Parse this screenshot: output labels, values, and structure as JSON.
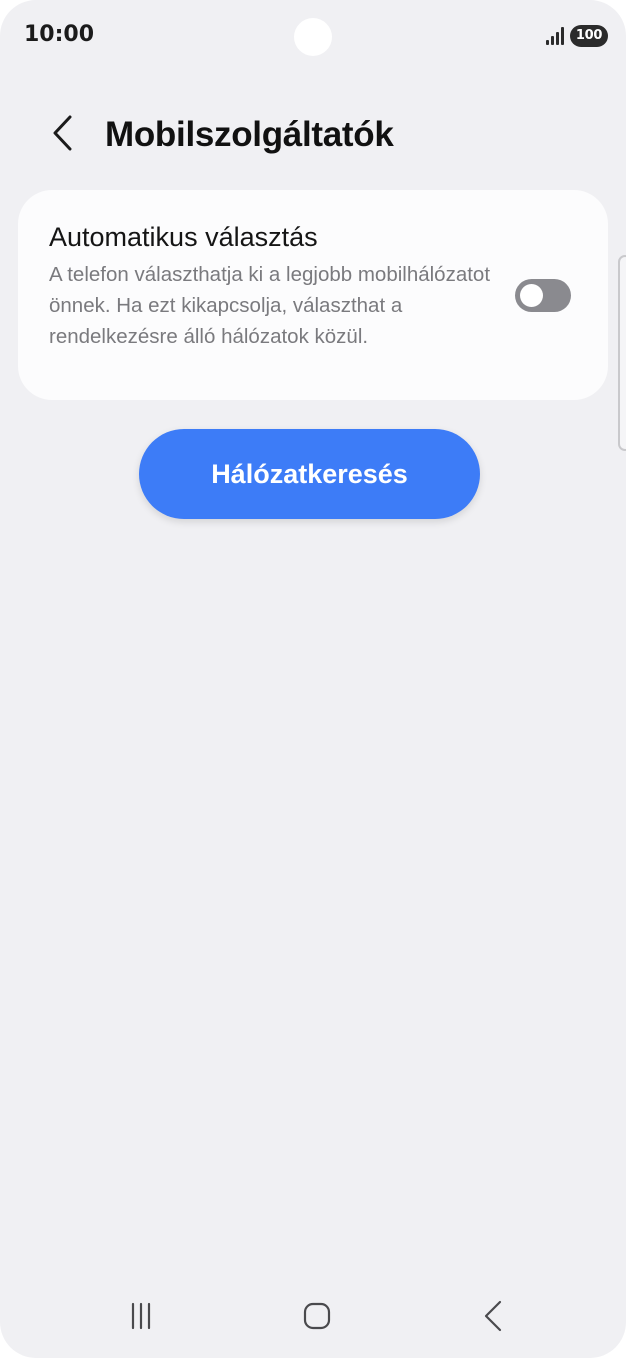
{
  "status_bar": {
    "time": "10:00",
    "battery": "100",
    "signal_icon": "signal-icon",
    "battery_icon": "battery-icon"
  },
  "header": {
    "back_icon": "chevron-left-icon",
    "title": "Mobilszolgáltatók"
  },
  "setting": {
    "title": "Automatikus választás",
    "description": "A telefon választhatja ki a legjobb mobilhálózatot önnek. Ha ezt kikapcsolja, választhat a rendelkezésre álló hálózatok közül.",
    "toggle_on": false
  },
  "search_button": {
    "label": "Hálózatkeresés"
  },
  "nav_bar": {
    "recent_icon": "recent-apps-icon",
    "home_icon": "home-icon",
    "back_icon": "back-icon"
  },
  "colors": {
    "background": "#f0f0f3",
    "card": "#fcfcfd",
    "accent": "#3d7cf7",
    "toggle_off": "#8a8a8f"
  }
}
